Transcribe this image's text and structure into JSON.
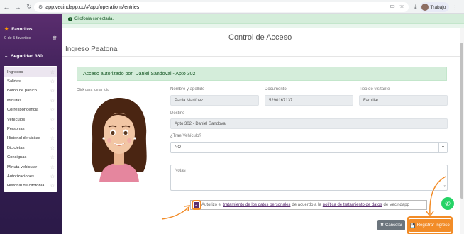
{
  "browser": {
    "url": "app.vecindapp.co/#/app/operations/entries",
    "profile_name": "Trabajo"
  },
  "sidebar": {
    "favorites_title": "Favoritos",
    "favorites_count": "0 de 5 favoritos",
    "section_title": "Seguridad 360",
    "items": [
      {
        "label": "Ingresos"
      },
      {
        "label": "Salidas"
      },
      {
        "label": "Botón de pánico"
      },
      {
        "label": "Minutas"
      },
      {
        "label": "Correspondencia"
      },
      {
        "label": "Vehículos"
      },
      {
        "label": "Personas"
      },
      {
        "label": "Historial de visitas"
      },
      {
        "label": "Bicicletas"
      },
      {
        "label": "Consignas"
      },
      {
        "label": "Minuta vehicular"
      },
      {
        "label": "Autorizaciones"
      },
      {
        "label": "Historial de citofonía"
      }
    ]
  },
  "banner": {
    "text": "Citofonía conectada."
  },
  "header": {
    "control_title": "Control de Acceso",
    "page_title": "Ingreso Peatonal"
  },
  "auth_message": "Acceso autorizado por: Daniel Sandoval - Apto 302",
  "photo_label": "Click para tomar foto",
  "form": {
    "name_label": "Nombre y apellido",
    "name_value": "Paola Martínez",
    "document_label": "Documento",
    "document_value": "5290167137",
    "visitor_type_label": "Tipo de visitante",
    "visitor_type_value": "Familiar",
    "destination_label": "Destino",
    "destination_value": "Apto 302 - Daniel Sandoval",
    "vehicle_label": "¿Trae Vehículo?",
    "vehicle_value": "NO",
    "notes_placeholder": "Notas"
  },
  "consent": {
    "prefix": "Autorizo el",
    "link1": "tratamiento de los datos personales",
    "middle": "de acuerdo a la",
    "link2": "política de tratamiento de datos",
    "suffix": "de Vecindapp"
  },
  "buttons": {
    "cancel": "Cancelar",
    "register": "Registrar Ingreso"
  },
  "colors": {
    "sidebar": "#3a1f55",
    "success_bg": "#d4edda",
    "accent": "#f28c28",
    "cancel": "#6c757d"
  }
}
